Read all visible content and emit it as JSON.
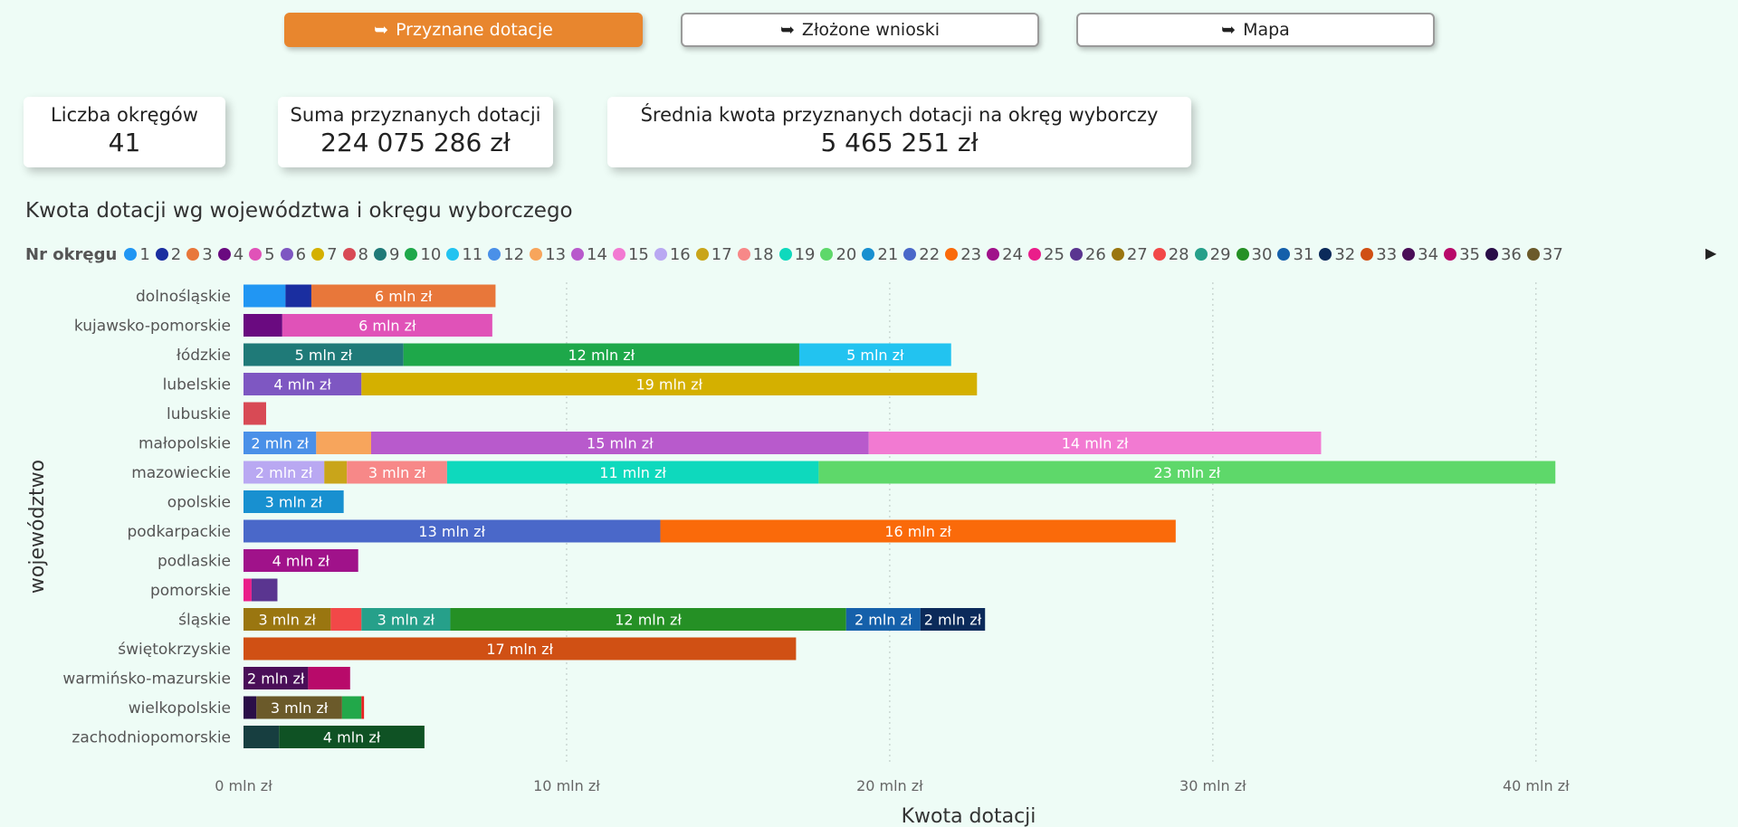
{
  "nav": {
    "arrow": "➥",
    "tabs": [
      {
        "label": "Przyznane dotacje",
        "active": true
      },
      {
        "label": "Złożone wnioski",
        "active": false
      },
      {
        "label": "Mapa",
        "active": false
      }
    ]
  },
  "kpis": [
    {
      "label": "Liczba okręgów",
      "value": "41"
    },
    {
      "label": "Suma przyznanych dotacji",
      "value": "224 075 286 zł"
    },
    {
      "label": "Średnia kwota przyznanych dotacji na okręg wyborczy",
      "value": "5 465 251 zł"
    }
  ],
  "legend": {
    "title": "Nr okręgu",
    "items": [
      {
        "label": "1",
        "color": "#2196f3"
      },
      {
        "label": "2",
        "color": "#1a2ea0"
      },
      {
        "label": "3",
        "color": "#e8773a"
      },
      {
        "label": "4",
        "color": "#6a0a80"
      },
      {
        "label": "5",
        "color": "#e052b8"
      },
      {
        "label": "6",
        "color": "#7e57c2"
      },
      {
        "label": "7",
        "color": "#d4b000"
      },
      {
        "label": "8",
        "color": "#d84a55"
      },
      {
        "label": "9",
        "color": "#1f7a78"
      },
      {
        "label": "10",
        "color": "#1ea84a"
      },
      {
        "label": "11",
        "color": "#22c3f0"
      },
      {
        "label": "12",
        "color": "#4a90e8"
      },
      {
        "label": "13",
        "color": "#f7a55c"
      },
      {
        "label": "14",
        "color": "#b85acc"
      },
      {
        "label": "15",
        "color": "#f27ad2"
      },
      {
        "label": "16",
        "color": "#b9a8f2"
      },
      {
        "label": "17",
        "color": "#c9a51a"
      },
      {
        "label": "18",
        "color": "#f78888"
      },
      {
        "label": "19",
        "color": "#0ed9bd"
      },
      {
        "label": "20",
        "color": "#5ed86a"
      },
      {
        "label": "21",
        "color": "#1890d0"
      },
      {
        "label": "22",
        "color": "#4a68c9"
      },
      {
        "label": "23",
        "color": "#fa6a0a"
      },
      {
        "label": "24",
        "color": "#a0128a"
      },
      {
        "label": "25",
        "color": "#ea1e8a"
      },
      {
        "label": "26",
        "color": "#5a3590"
      },
      {
        "label": "27",
        "color": "#9a7610"
      },
      {
        "label": "28",
        "color": "#f24848"
      },
      {
        "label": "29",
        "color": "#26a08a"
      },
      {
        "label": "30",
        "color": "#259025"
      },
      {
        "label": "31",
        "color": "#1560aa"
      },
      {
        "label": "32",
        "color": "#0b2a5a"
      },
      {
        "label": "33",
        "color": "#d05014"
      },
      {
        "label": "34",
        "color": "#4a0e58"
      },
      {
        "label": "35",
        "color": "#b80a6a"
      },
      {
        "label": "36",
        "color": "#2a0e48"
      },
      {
        "label": "37",
        "color": "#6b5a2a"
      }
    ],
    "next_glyph": "▶"
  },
  "chart_data": {
    "type": "bar",
    "orientation": "horizontal",
    "stacked": true,
    "title": "Kwota dotacji wg województwa i okręgu wyborczego",
    "xlabel": "Kwota dotacji",
    "ylabel": "województwo",
    "xlim": [
      0,
      46
    ],
    "x_ticks": [
      0,
      10,
      20,
      30,
      40
    ],
    "x_tick_labels": [
      "0 mln zł",
      "10 mln zł",
      "20 mln zł",
      "30 mln zł",
      "40 mln zł"
    ],
    "grid": "vertical dotted",
    "legend_title": "Nr okręgu",
    "legend_position": "top",
    "units": "mln zł",
    "categories": [
      "dolnośląskie",
      "kujawsko-pomorskie",
      "łódzkie",
      "lubelskie",
      "lubuskie",
      "małopolskie",
      "mazowieckie",
      "opolskie",
      "podkarpackie",
      "podlaskie",
      "pomorskie",
      "śląskie",
      "świętokrzyskie",
      "warmińsko-mazurskie",
      "wielkopolskie",
      "zachodniopomorskie"
    ],
    "rows": [
      {
        "category": "dolnośląskie",
        "segments": [
          {
            "district": "1",
            "value": 1.3,
            "color": "#2196f3",
            "label": ""
          },
          {
            "district": "2",
            "value": 0.8,
            "color": "#1a2ea0",
            "label": ""
          },
          {
            "district": "3",
            "value": 5.7,
            "color": "#e8773a",
            "label": "6 mln zł"
          }
        ]
      },
      {
        "category": "kujawsko-pomorskie",
        "segments": [
          {
            "district": "4",
            "value": 1.2,
            "color": "#6a0a80",
            "label": ""
          },
          {
            "district": "5",
            "value": 6.5,
            "color": "#e052b8",
            "label": "6 mln zł"
          }
        ]
      },
      {
        "category": "łódzkie",
        "segments": [
          {
            "district": "9",
            "value": 4.95,
            "color": "#1f7a78",
            "label": "5 mln zł"
          },
          {
            "district": "10",
            "value": 12.25,
            "color": "#1ea84a",
            "label": "12 mln zł"
          },
          {
            "district": "11",
            "value": 4.7,
            "color": "#22c3f0",
            "label": "5 mln zł"
          }
        ]
      },
      {
        "category": "lubelskie",
        "segments": [
          {
            "district": "6",
            "value": 3.65,
            "color": "#7e57c2",
            "label": "4 mln zł"
          },
          {
            "district": "7",
            "value": 19.05,
            "color": "#d4b000",
            "label": "19 mln zł"
          }
        ]
      },
      {
        "category": "lubuskie",
        "segments": [
          {
            "district": "8",
            "value": 0.7,
            "color": "#d84a55",
            "label": ""
          }
        ]
      },
      {
        "category": "małopolskie",
        "segments": [
          {
            "district": "12",
            "value": 2.25,
            "color": "#4a90e8",
            "label": "2 mln zł"
          },
          {
            "district": "13",
            "value": 1.7,
            "color": "#f7a55c",
            "label": ""
          },
          {
            "district": "14",
            "value": 15.4,
            "color": "#b85acc",
            "label": "15 mln zł"
          },
          {
            "district": "15",
            "value": 14.0,
            "color": "#f27ad2",
            "label": "14 mln zł"
          }
        ]
      },
      {
        "category": "mazowieckie",
        "segments": [
          {
            "district": "16",
            "value": 2.5,
            "color": "#b9a8f2",
            "label": "2 mln zł"
          },
          {
            "district": "17",
            "value": 0.7,
            "color": "#c9a51a",
            "label": ""
          },
          {
            "district": "18",
            "value": 3.1,
            "color": "#f78888",
            "label": "3 mln zł"
          },
          {
            "district": "19",
            "value": 11.5,
            "color": "#0ed9bd",
            "label": "11 mln zł"
          },
          {
            "district": "20",
            "value": 22.8,
            "color": "#5ed86a",
            "label": "23 mln zł"
          }
        ]
      },
      {
        "category": "opolskie",
        "segments": [
          {
            "district": "21",
            "value": 3.1,
            "color": "#1890d0",
            "label": "3 mln zł"
          }
        ]
      },
      {
        "category": "podkarpackie",
        "segments": [
          {
            "district": "22",
            "value": 12.9,
            "color": "#4a68c9",
            "label": "13 mln zł"
          },
          {
            "district": "23",
            "value": 15.95,
            "color": "#fa6a0a",
            "label": "16 mln zł"
          }
        ]
      },
      {
        "category": "podlaskie",
        "segments": [
          {
            "district": "24",
            "value": 3.55,
            "color": "#a0128a",
            "label": "4 mln zł"
          }
        ]
      },
      {
        "category": "pomorskie",
        "segments": [
          {
            "district": "25",
            "value": 0.25,
            "color": "#ea1e8a",
            "label": ""
          },
          {
            "district": "26",
            "value": 0.8,
            "color": "#5a3590",
            "label": ""
          }
        ]
      },
      {
        "category": "śląskie",
        "segments": [
          {
            "district": "27",
            "value": 2.7,
            "color": "#9a7610",
            "label": "3 mln zł"
          },
          {
            "district": "28",
            "value": 0.95,
            "color": "#f24848",
            "label": ""
          },
          {
            "district": "29",
            "value": 2.75,
            "color": "#26a08a",
            "label": "3 mln zł"
          },
          {
            "district": "30",
            "value": 12.25,
            "color": "#259025",
            "label": "12 mln zł"
          },
          {
            "district": "31",
            "value": 2.3,
            "color": "#1560aa",
            "label": "2 mln zł"
          },
          {
            "district": "32",
            "value": 2.0,
            "color": "#0b2a5a",
            "label": "2 mln zł"
          }
        ]
      },
      {
        "category": "świętokrzyskie",
        "segments": [
          {
            "district": "33",
            "value": 17.1,
            "color": "#d05014",
            "label": "17 mln zł"
          }
        ]
      },
      {
        "category": "warmińsko-mazurskie",
        "segments": [
          {
            "district": "34",
            "value": 2.0,
            "color": "#4a0e58",
            "label": "2 mln zł"
          },
          {
            "district": "35",
            "value": 1.3,
            "color": "#b80a6a",
            "label": ""
          }
        ]
      },
      {
        "category": "wielkopolskie",
        "segments": [
          {
            "district": "36",
            "value": 0.4,
            "color": "#2a0e48",
            "label": ""
          },
          {
            "district": "37",
            "value": 2.65,
            "color": "#6b5a2a",
            "label": "3 mln zł"
          },
          {
            "district": "",
            "value": 0.6,
            "color": "#22a84a",
            "label": ""
          },
          {
            "district": "",
            "value": 0.08,
            "color": "#e82020",
            "label": ""
          }
        ]
      },
      {
        "category": "zachodniopomorskie",
        "segments": [
          {
            "district": "",
            "value": 1.1,
            "color": "#173e40",
            "label": ""
          },
          {
            "district": "",
            "value": 4.5,
            "color": "#0f5224",
            "label": "4 mln zł"
          }
        ]
      }
    ]
  }
}
